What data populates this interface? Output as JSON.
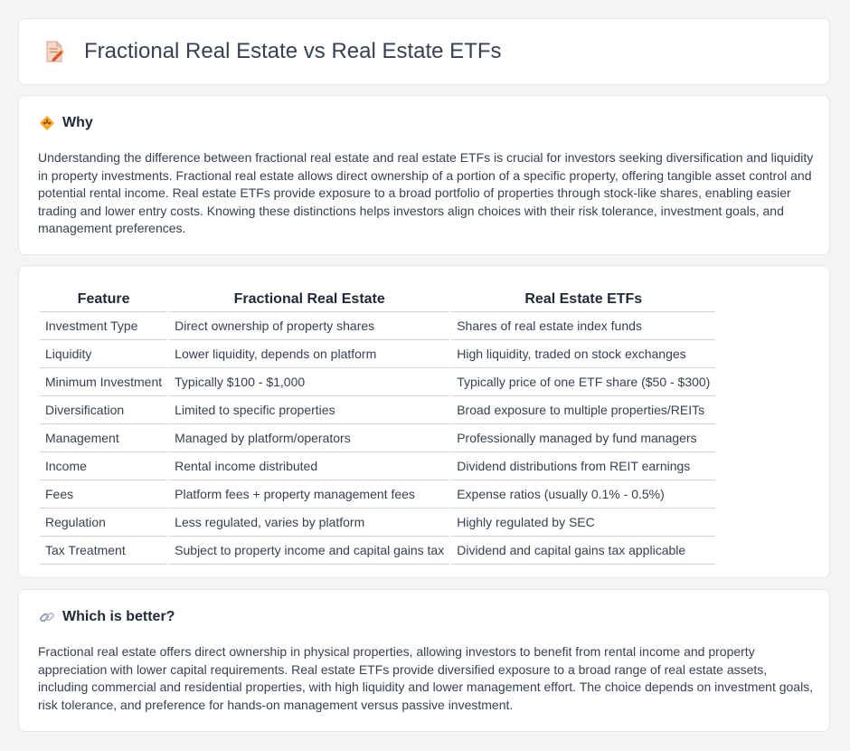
{
  "header": {
    "title": "Fractional Real Estate vs Real Estate ETFs",
    "icon": "document-pencil-icon"
  },
  "why": {
    "icon": "diamond-warning-icon",
    "title": "Why",
    "text": "Understanding the difference between fractional real estate and real estate ETFs is crucial for investors seeking diversification and liquidity in property investments. Fractional real estate allows direct ownership of a portion of a specific property, offering tangible asset control and potential rental income. Real estate ETFs provide exposure to a broad portfolio of properties through stock-like shares, enabling easier trading and lower entry costs. Knowing these distinctions helps investors align choices with their risk tolerance, investment goals, and management preferences."
  },
  "table": {
    "headers": [
      "Feature",
      "Fractional Real Estate",
      "Real Estate ETFs"
    ],
    "rows": [
      [
        "Investment Type",
        "Direct ownership of property shares",
        "Shares of real estate index funds"
      ],
      [
        "Liquidity",
        "Lower liquidity, depends on platform",
        "High liquidity, traded on stock exchanges"
      ],
      [
        "Minimum Investment",
        "Typically $100 - $1,000",
        "Typically price of one ETF share ($50 - $300)"
      ],
      [
        "Diversification",
        "Limited to specific properties",
        "Broad exposure to multiple properties/REITs"
      ],
      [
        "Management",
        "Managed by platform/operators",
        "Professionally managed by fund managers"
      ],
      [
        "Income",
        "Rental income distributed",
        "Dividend distributions from REIT earnings"
      ],
      [
        "Fees",
        "Platform fees + property management fees",
        "Expense ratios (usually 0.1% - 0.5%)"
      ],
      [
        "Regulation",
        "Less regulated, varies by platform",
        "Highly regulated by SEC"
      ],
      [
        "Tax Treatment",
        "Subject to property income and capital gains tax",
        "Dividend and capital gains tax applicable"
      ]
    ]
  },
  "better": {
    "icon": "link-icon",
    "title": "Which is better?",
    "text": "Fractional real estate offers direct ownership in physical properties, allowing investors to benefit from rental income and property appreciation with lower capital requirements. Real estate ETFs provide diversified exposure to a broad range of real estate assets, including commercial and residential properties, with high liquidity and lower management effort. The choice depends on investment goals, risk tolerance, and preference for hands-on management versus passive investment."
  }
}
